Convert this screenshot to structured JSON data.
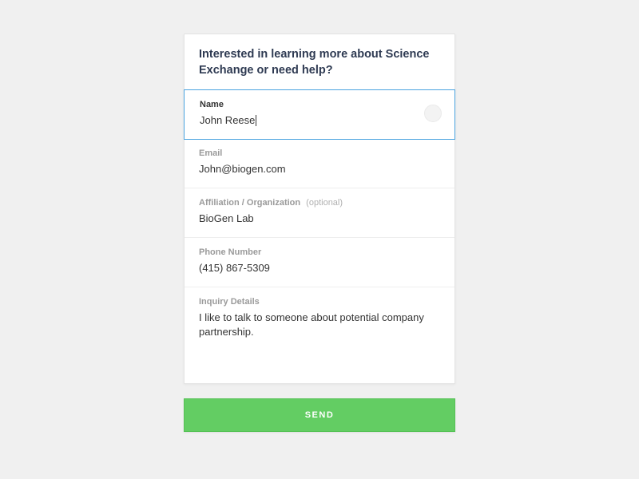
{
  "header": {
    "title": "Interested in learning more about Science Exchange or need help?"
  },
  "fields": {
    "name": {
      "label": "Name",
      "value": "John Reese"
    },
    "email": {
      "label": "Email",
      "value": "John@biogen.com"
    },
    "affiliation": {
      "label": "Affiliation / Organization",
      "optional": "(optional)",
      "value": "BioGen Lab"
    },
    "phone": {
      "label": "Phone Number",
      "value": "(415) 867-5309"
    },
    "inquiry": {
      "label": "Inquiry Details",
      "value": "I like to talk to someone about potential company partnership."
    }
  },
  "send_label": "SEND"
}
